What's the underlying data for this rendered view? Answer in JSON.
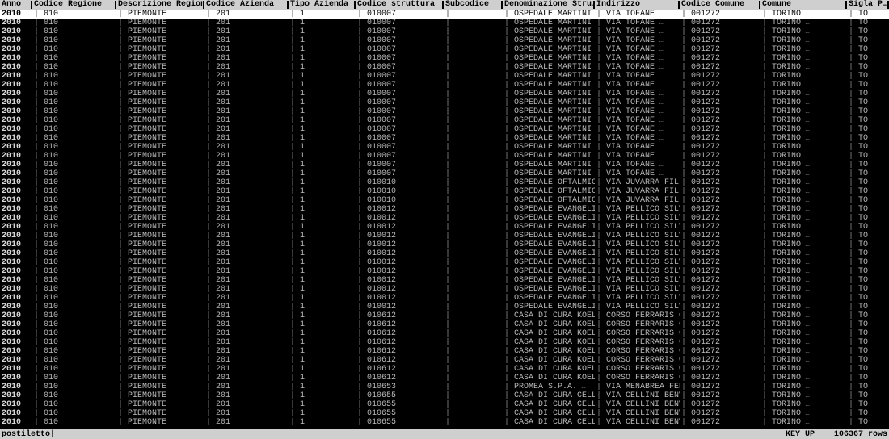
{
  "columns": [
    {
      "key": "anno",
      "label": "Anno",
      "width": 40,
      "cls": "anno"
    },
    {
      "key": "codice_regione",
      "label": "Codice Regione",
      "width": 104,
      "cls": "cell"
    },
    {
      "key": "descrizione_regione",
      "label": "Descrizione Region…",
      "width": 109,
      "cls": "cell"
    },
    {
      "key": "codice_azienda",
      "label": "Codice Azienda",
      "width": 104,
      "cls": "cell"
    },
    {
      "key": "tipo_azienda",
      "label": "Tipo Azienda",
      "width": 83,
      "cls": "cell"
    },
    {
      "key": "codice_struttura",
      "label": "Codice struttura",
      "width": 109,
      "cls": "cell"
    },
    {
      "key": "subcodice",
      "label": "Subcodice",
      "width": 73,
      "cls": "cell"
    },
    {
      "key": "denominazione",
      "label": "Denominazione Stru…",
      "width": 114,
      "cls": "cell ellip"
    },
    {
      "key": "indirizzo",
      "label": "Indirizzo",
      "width": 105,
      "cls": "cell ellip"
    },
    {
      "key": "codice_comune",
      "label": "Codice Comune",
      "width": 100,
      "cls": "cell"
    },
    {
      "key": "comune",
      "label": "Comune",
      "width": 107,
      "cls": "cell ellip"
    },
    {
      "key": "sigla_p",
      "label": "Sigla P…",
      "width": 52,
      "cls": "cell"
    }
  ],
  "groups": [
    {
      "count": 19,
      "row": {
        "anno": "2010",
        "codice_regione": "010",
        "descrizione_regione": "PIEMONTE",
        "codice_azienda": "201",
        "tipo_azienda": "1",
        "codice_struttura": "010007",
        "subcodice": "",
        "denominazione": "OSPEDALE MARTINI",
        "indirizzo": "VIA TOFANE",
        "codice_comune": "001272",
        "comune": "TORINO",
        "sigla_p": "TO"
      }
    },
    {
      "count": 3,
      "row": {
        "anno": "2010",
        "codice_regione": "010",
        "descrizione_regione": "PIEMONTE",
        "codice_azienda": "201",
        "tipo_azienda": "1",
        "codice_struttura": "010010",
        "subcodice": "",
        "denominazione": "OSPEDALE OFTALMICO…",
        "indirizzo": "VIA JUVARRA FILIPP…",
        "codice_comune": "001272",
        "comune": "TORINO",
        "sigla_p": "TO"
      }
    },
    {
      "count": 12,
      "row": {
        "anno": "2010",
        "codice_regione": "010",
        "descrizione_regione": "PIEMONTE",
        "codice_azienda": "201",
        "tipo_azienda": "1",
        "codice_struttura": "010012",
        "subcodice": "",
        "denominazione": "OSPEDALE EVANGELIC…",
        "indirizzo": "VIA PELLICO SILVIO…",
        "codice_comune": "001272",
        "comune": "TORINO",
        "sigla_p": "TO"
      }
    },
    {
      "count": 8,
      "row": {
        "anno": "2010",
        "codice_regione": "010",
        "descrizione_regione": "PIEMONTE",
        "codice_azienda": "201",
        "tipo_azienda": "1",
        "codice_struttura": "010612",
        "subcodice": "",
        "denominazione": "CASA DI CURA KOELL…",
        "indirizzo": "CORSO FERRARIS GAL…",
        "codice_comune": "001272",
        "comune": "TORINO",
        "sigla_p": "TO"
      }
    },
    {
      "count": 1,
      "row": {
        "anno": "2010",
        "codice_regione": "010",
        "descrizione_regione": "PIEMONTE",
        "codice_azienda": "201",
        "tipo_azienda": "1",
        "codice_struttura": "010653",
        "subcodice": "",
        "denominazione": "PROMEA S.P.A.",
        "indirizzo": "VIA MENABREA FEDER…",
        "codice_comune": "001272",
        "comune": "TORINO",
        "sigla_p": "TO"
      }
    },
    {
      "count": 4,
      "row": {
        "anno": "2010",
        "codice_regione": "010",
        "descrizione_regione": "PIEMONTE",
        "codice_azienda": "201",
        "tipo_azienda": "1",
        "codice_struttura": "010655",
        "subcodice": "",
        "denominazione": "CASA DI CURA CELLI…",
        "indirizzo": "VIA CELLINI BENVEN…",
        "codice_comune": "001272",
        "comune": "TORINO",
        "sigla_p": "TO"
      }
    }
  ],
  "selected_row_index": 0,
  "status": {
    "left": "postiletto|",
    "key": "KEY UP",
    "rowcount": "106367 rows"
  }
}
